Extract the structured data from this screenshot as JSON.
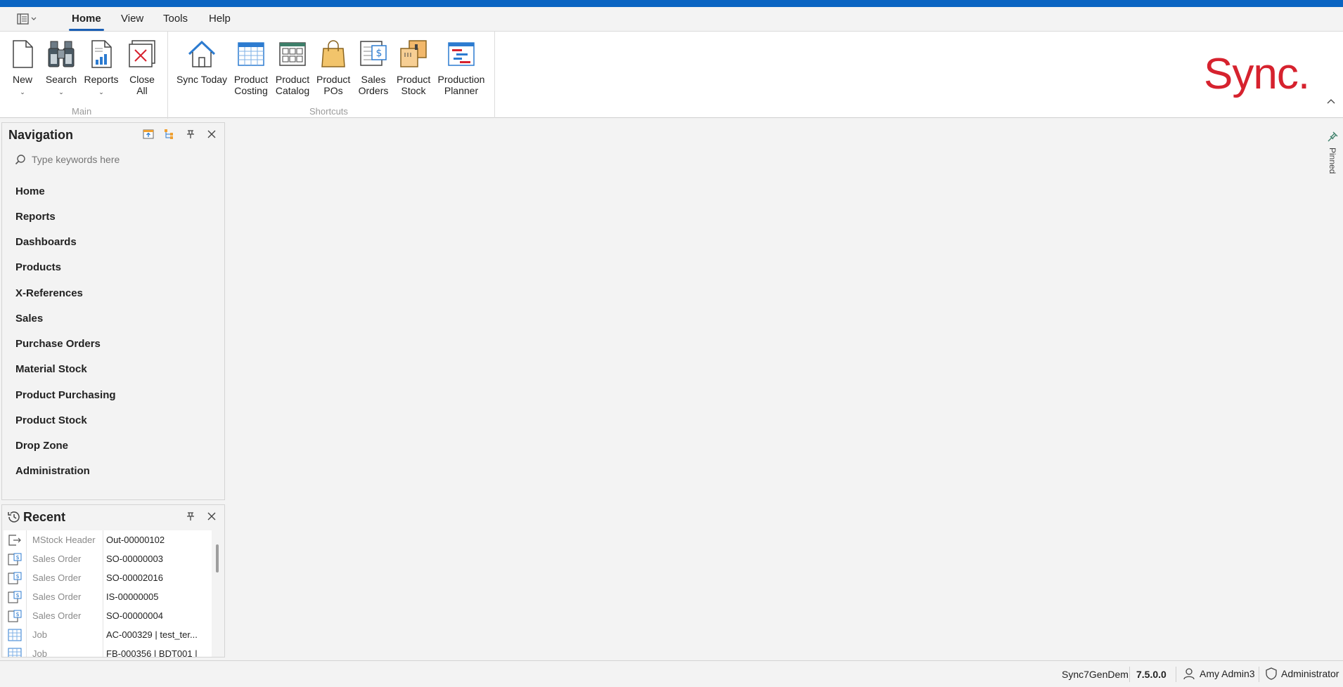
{
  "menu": {
    "tabs": [
      "Home",
      "View",
      "Tools",
      "Help"
    ],
    "active_tab": "Home"
  },
  "ribbon": {
    "main_group": {
      "label": "Main",
      "buttons": [
        {
          "label1": "New",
          "label2": "",
          "dropdown": true
        },
        {
          "label1": "Search",
          "label2": "",
          "dropdown": true
        },
        {
          "label1": "Reports",
          "label2": "",
          "dropdown": true
        },
        {
          "label1": "Close",
          "label2": "All",
          "dropdown": false
        }
      ]
    },
    "shortcuts_group": {
      "label": "Shortcuts",
      "buttons": [
        {
          "label1": "Sync Today",
          "label2": ""
        },
        {
          "label1": "Product",
          "label2": "Costing"
        },
        {
          "label1": "Product",
          "label2": "Catalog"
        },
        {
          "label1": "Product",
          "label2": "POs"
        },
        {
          "label1": "Sales",
          "label2": "Orders"
        },
        {
          "label1": "Product",
          "label2": "Stock"
        },
        {
          "label1": "Production",
          "label2": "Planner"
        }
      ]
    },
    "logo_text": "Sync."
  },
  "navigation": {
    "title": "Navigation",
    "search_placeholder": "Type keywords here",
    "items": [
      "Home",
      "Reports",
      "Dashboards",
      "Products",
      "X-References",
      "Sales",
      "Purchase Orders",
      "Material Stock",
      "Product Purchasing",
      "Product Stock",
      "Drop Zone",
      "Administration"
    ]
  },
  "recent": {
    "title": "Recent",
    "rows": [
      {
        "icon": "exit-icon",
        "type": "MStock Header",
        "value": "Out-00000102"
      },
      {
        "icon": "sales-order-icon",
        "type": "Sales Order",
        "value": "SO-00000003"
      },
      {
        "icon": "sales-order-icon",
        "type": "Sales Order",
        "value": "SO-00002016"
      },
      {
        "icon": "sales-order-icon",
        "type": "Sales Order",
        "value": "IS-00000005"
      },
      {
        "icon": "sales-order-icon",
        "type": "Sales Order",
        "value": "SO-00000004"
      },
      {
        "icon": "job-icon",
        "type": "Job",
        "value": "AC-000329 | test_ter..."
      },
      {
        "icon": "job-icon",
        "type": "Job",
        "value": "FB-000356 | BDT001 |"
      }
    ]
  },
  "side": {
    "pinned_label": "Pinned"
  },
  "status": {
    "database": "Sync7GenDem",
    "version": "7.5.0.0",
    "user": "Amy Admin3",
    "role": "Administrator"
  },
  "colors": {
    "accent": "#0a64c2",
    "logo": "#d6222e"
  }
}
